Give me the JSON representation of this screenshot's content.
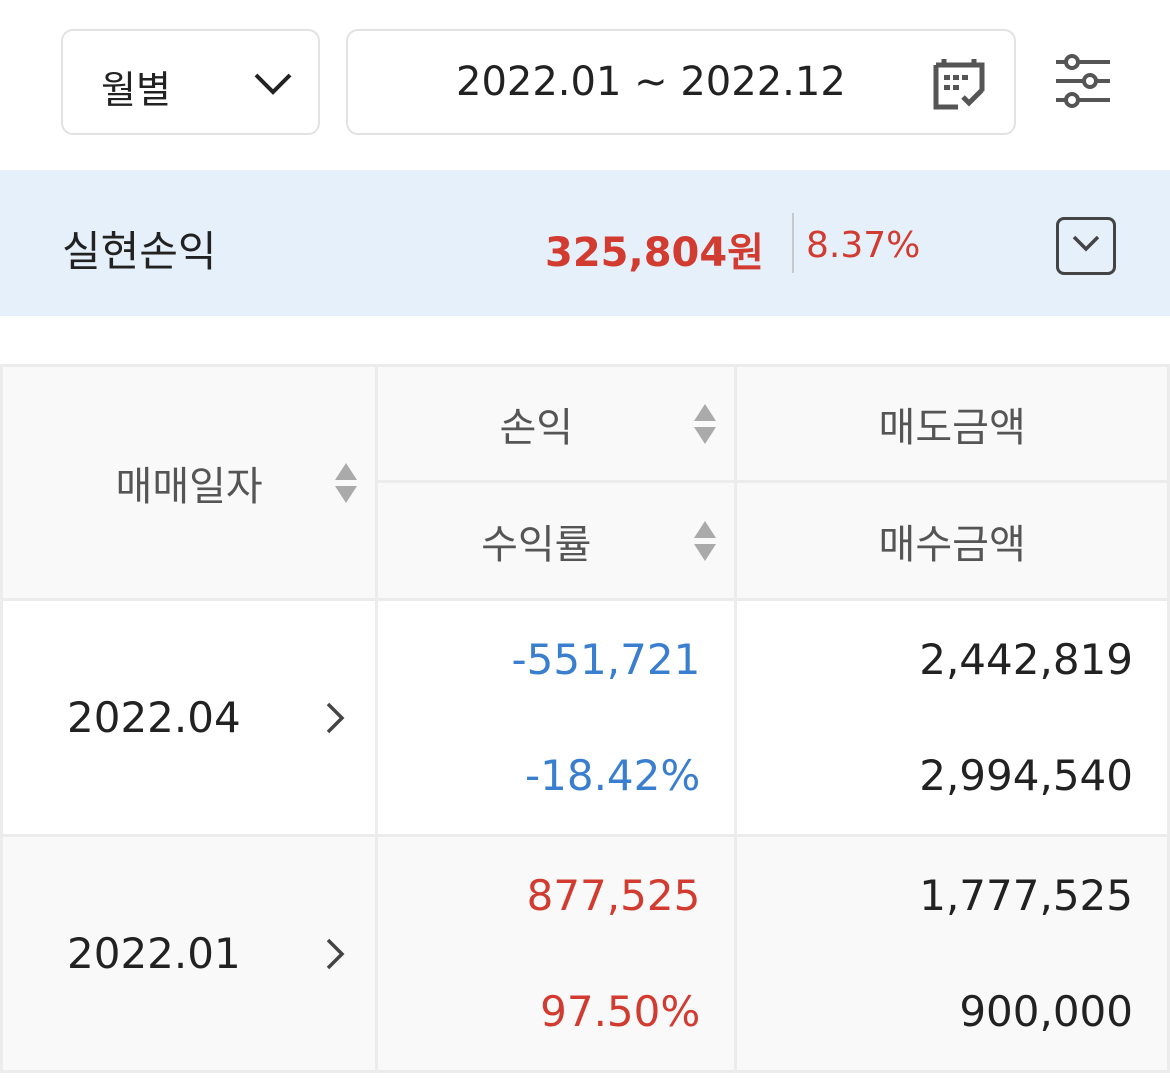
{
  "filters": {
    "period": "월별",
    "date_range": "2022.01 ~ 2022.12"
  },
  "summary": {
    "title": "실현손익",
    "amount": "325,804원",
    "rate": "8.37%"
  },
  "table": {
    "headers": {
      "date": "매매일자",
      "profit": "손익",
      "rate": "수익률",
      "sell": "매도금액",
      "buy": "매수금액"
    },
    "rows": [
      {
        "date": "2022.04",
        "profit": "-551,721",
        "rate": "-18.42%",
        "sell": "2,442,819",
        "buy": "2,994,540",
        "sign": "neg"
      },
      {
        "date": "2022.01",
        "profit": "877,525",
        "rate": "97.50%",
        "sell": "1,777,525",
        "buy": "900,000",
        "sign": "pos"
      }
    ]
  },
  "colors": {
    "positive": "#d23b30",
    "negative": "#3a7fcf",
    "summary_bg": "#e6f0fb"
  }
}
